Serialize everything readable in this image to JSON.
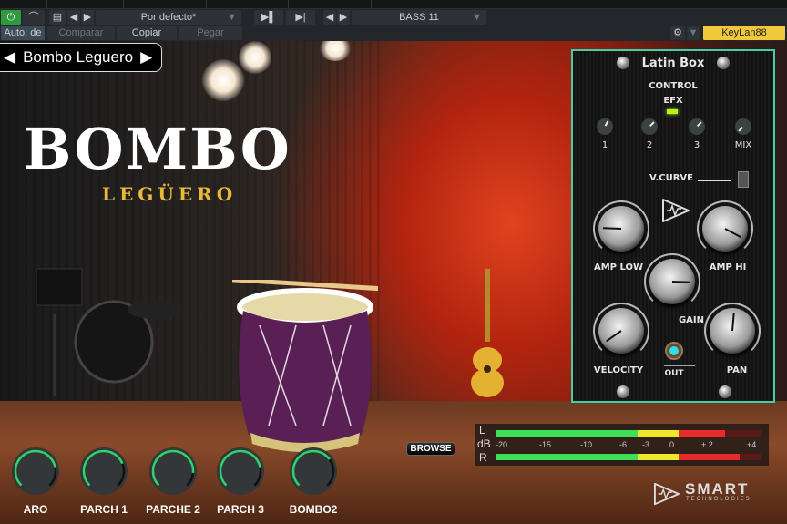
{
  "toolbar": {
    "preset": "Por defecto*",
    "instrument": "BASS 11",
    "auto": "Auto: de",
    "compare": "Comparar",
    "copy": "Copiar",
    "paste": "Pegar",
    "user": "KeyLan88"
  },
  "plugin": {
    "preset_name": "Bombo Leguero",
    "title": "BOMBO",
    "subtitle": "LEGÜERO",
    "browse": "BROWSE"
  },
  "latin_box": {
    "title": "Latin Box",
    "control": "CONTROL",
    "efx": "EFX",
    "efx_led": "#b8f21a",
    "efx_knobs": [
      {
        "label": "1",
        "angle": 30
      },
      {
        "label": "2",
        "angle": 45
      },
      {
        "label": "3",
        "angle": 45
      },
      {
        "label": "MIX",
        "angle": -135
      }
    ],
    "vcurve": "V.CURVE",
    "knobs": {
      "amp_low": {
        "label": "AMP LOW",
        "angle": -88
      },
      "amp_hi": {
        "label": "AMP HI",
        "angle": 118
      },
      "gain": {
        "label": "GAIN",
        "angle": 92
      },
      "velocity": {
        "label": "VELOCITY",
        "angle": -125
      },
      "pan": {
        "label": "PAN",
        "angle": 5
      }
    },
    "out": "OUT"
  },
  "meter": {
    "L": "L",
    "R": "R",
    "db": "dB",
    "ticks": [
      "-20",
      "-15",
      "-10",
      "-6",
      "-3",
      "0",
      "+ 2",
      "+4"
    ],
    "level_L": 11.3,
    "level_R": 12
  },
  "mix_knobs": [
    {
      "label": "ARO",
      "value": 0.8
    },
    {
      "label": "PARCH 1",
      "value": 0.75
    },
    {
      "label": "PARCHE 2",
      "value": 0.85
    },
    {
      "label": "PARCH 3",
      "value": 0.8
    },
    {
      "label": "BOMBO2",
      "value": 0.7
    }
  ],
  "brand": {
    "name": "SMART",
    "sub": "TECHNOLOGIES"
  },
  "colors": {
    "accent": "#3fd0a5",
    "knob_arc": "#2fd36a",
    "license": "#f0c93a"
  }
}
